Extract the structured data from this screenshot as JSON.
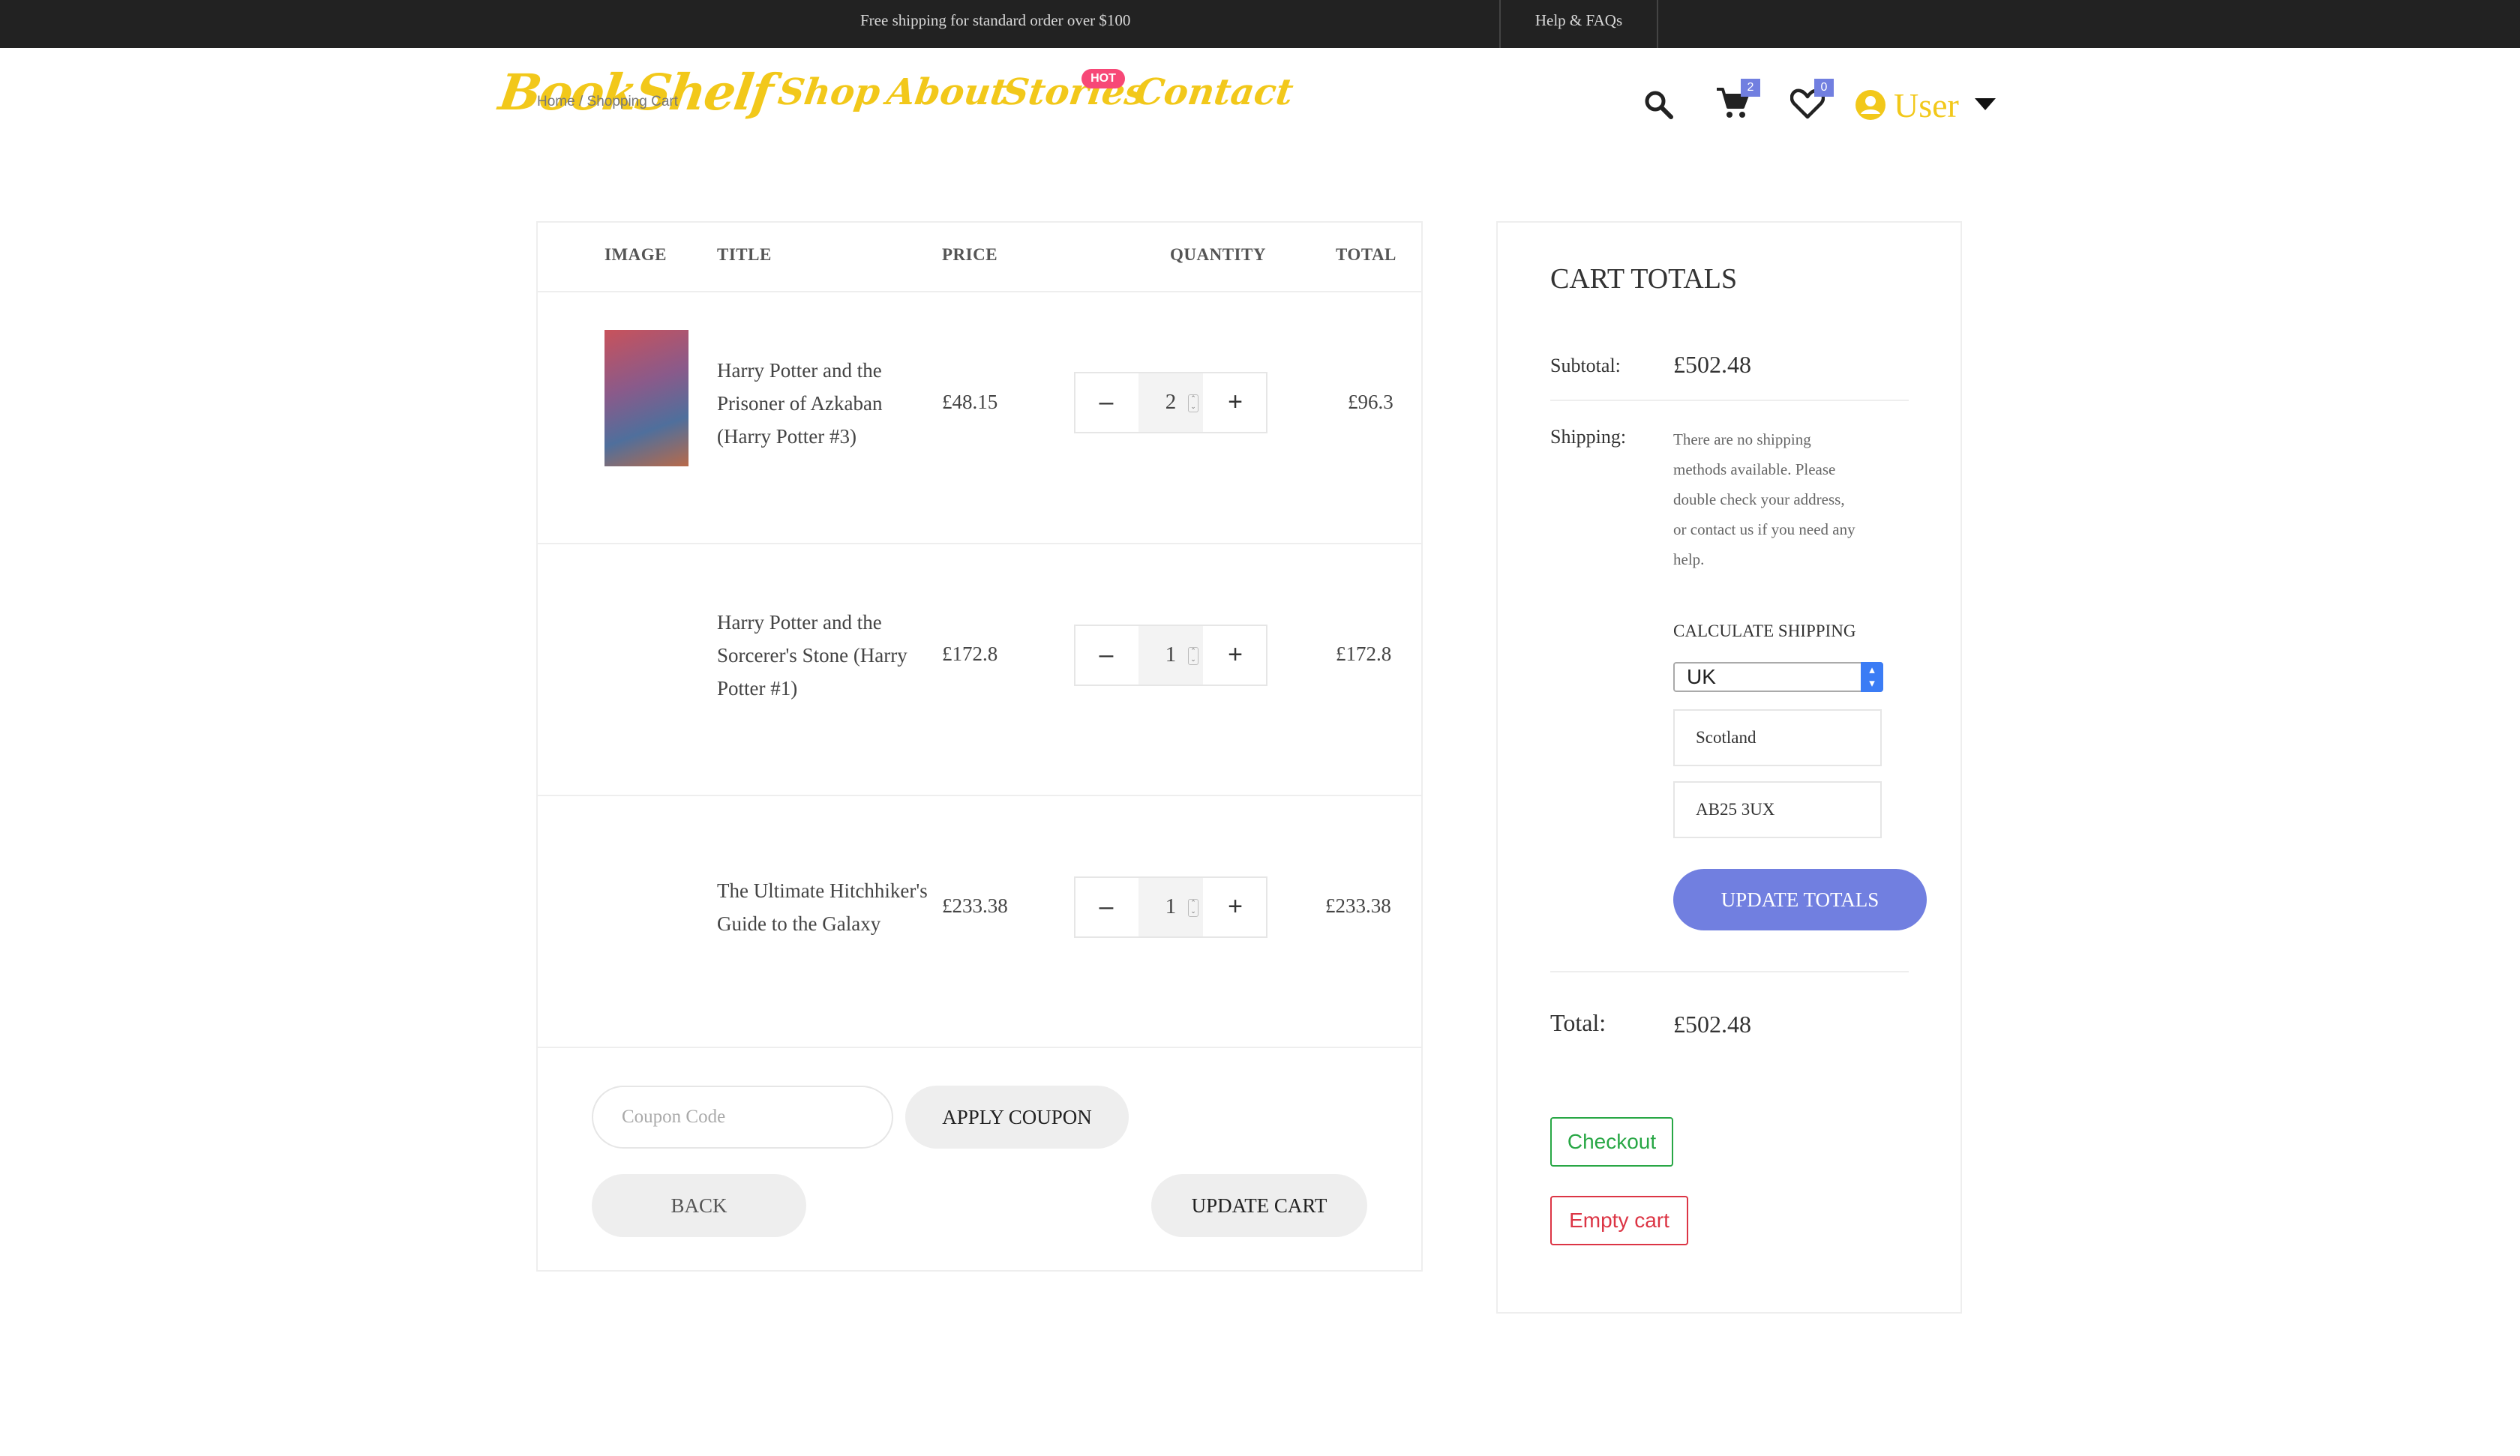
{
  "topbar": {
    "promo": "Free shipping for standard order over $100",
    "help": "Help & FAQs"
  },
  "header": {
    "logo": "BookShelf",
    "breadcrumb": "Home / Shopping Cart",
    "nav": [
      "Shop",
      "About",
      "Stories",
      "Contact"
    ],
    "hot_badge": "HOT",
    "cart_count": "2",
    "wishlist_count": "0",
    "user_label": "User"
  },
  "table": {
    "headers": {
      "image": "IMAGE",
      "title": "TITLE",
      "price": "PRICE",
      "quantity": "QUANTITY",
      "total": "TOTAL"
    },
    "rows": [
      {
        "title_lines": [
          "Harry Potter and the",
          "Prisoner of Azkaban",
          "(Harry Potter #3)"
        ],
        "price": "£48.15",
        "qty": "2",
        "total": "£96.3"
      },
      {
        "title_lines": [
          "Harry Potter and the",
          "Sorcerer's Stone (Harry",
          "Potter #1)"
        ],
        "price": "£172.8",
        "qty": "1",
        "total": "£172.8"
      },
      {
        "title_lines": [
          "The Ultimate Hitchhiker's",
          "Guide to the Galaxy"
        ],
        "price": "£233.38",
        "qty": "1",
        "total": "£233.38"
      }
    ],
    "minus_symbol": "–",
    "plus_symbol": "+"
  },
  "coupon": {
    "placeholder": "Coupon Code",
    "apply": "APPLY COUPON"
  },
  "actions": {
    "back": "BACK",
    "update_cart": "UPDATE CART"
  },
  "totals": {
    "heading": "CART TOTALS",
    "subtotal_label": "Subtotal:",
    "subtotal_value": "£502.48",
    "shipping_label": "Shipping:",
    "shipping_lines": [
      "There are no shipping",
      "methods available. Please",
      "double check your address,",
      "or contact us if you need any",
      "help."
    ],
    "calc_label": "CALCULATE SHIPPING",
    "country": "UK",
    "state": "Scotland",
    "postcode": "AB25 3UX",
    "update_totals": "UPDATE TOTALS",
    "total_label": "Total:",
    "total_value": "£502.48",
    "checkout": "Checkout",
    "empty_cart": "Empty cart"
  },
  "colors": {
    "accent": "#717fe0",
    "logo_yellow": "#f2c81a",
    "hot": "#f74877",
    "checkout": "#28a745",
    "danger": "#dc3545"
  }
}
